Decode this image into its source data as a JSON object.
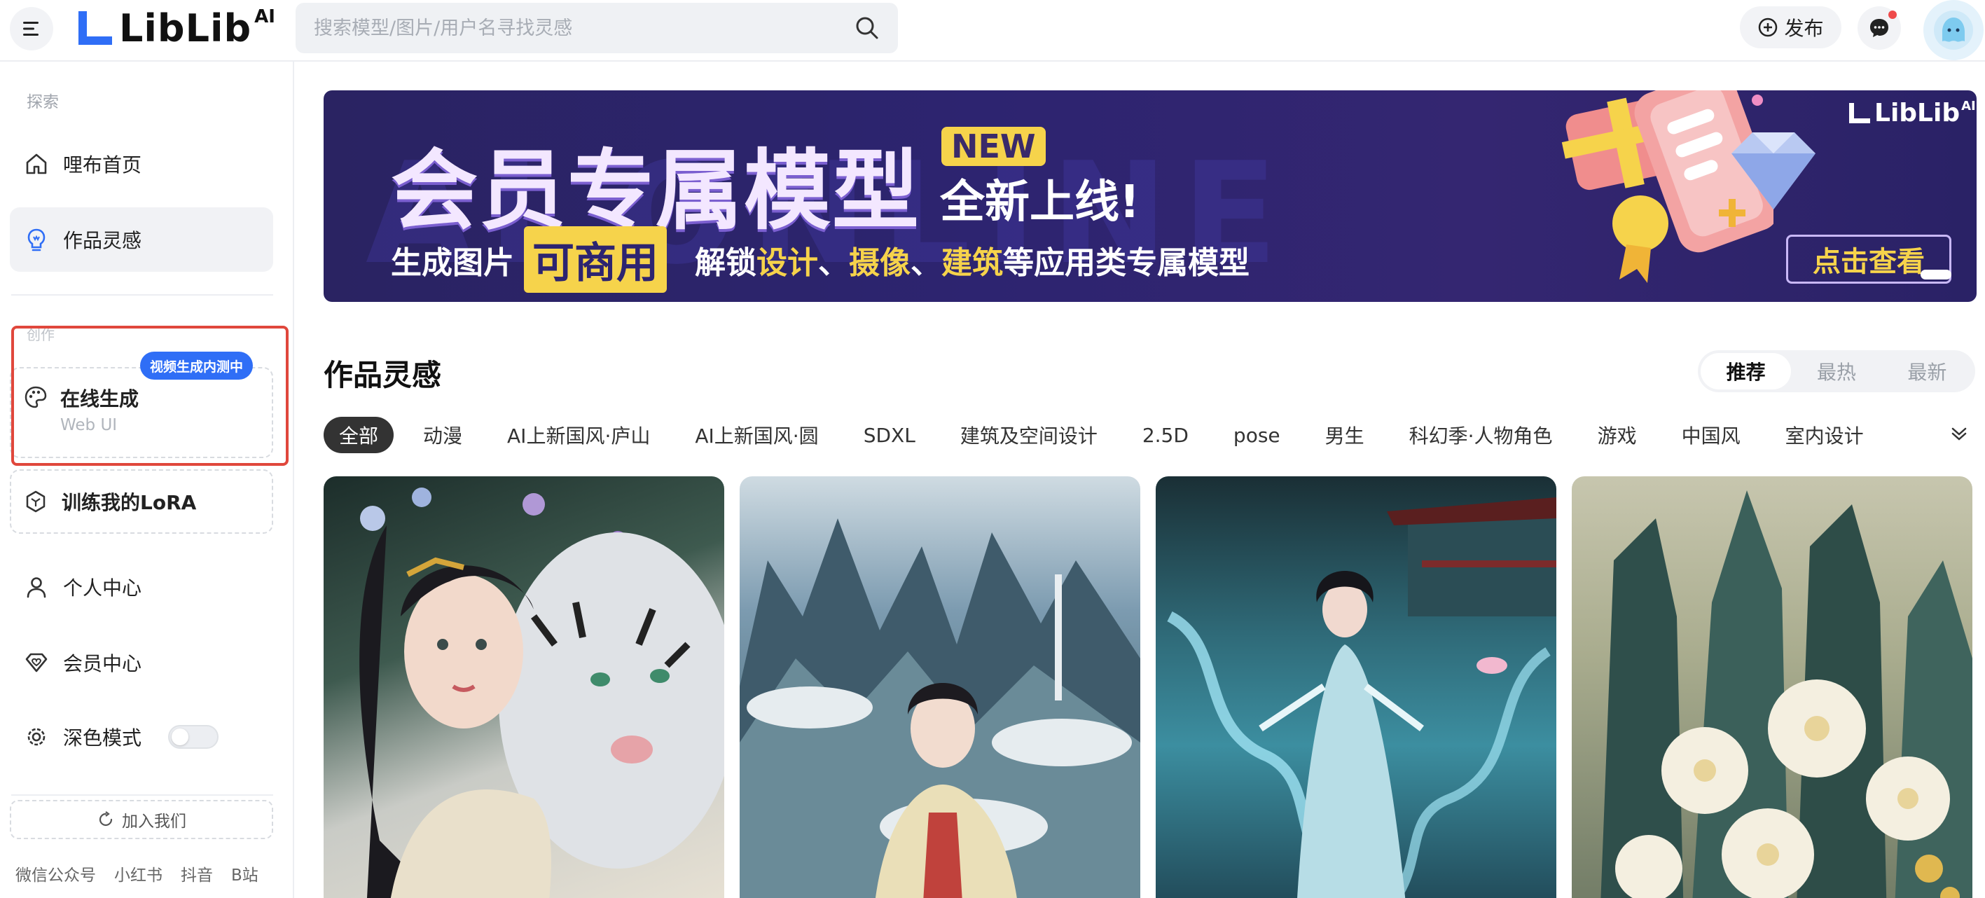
{
  "header": {
    "logo_text": "LibLib",
    "logo_suffix": "AI",
    "search_placeholder": "搜索模型/图片/用户名寻找灵感",
    "publish_label": "发布"
  },
  "sidebar": {
    "explore_label": "探索",
    "home_label": "哩布首页",
    "inspiration_label": "作品灵感",
    "create_label": "创作",
    "online_gen_title": "在线生成",
    "online_gen_sub": "Web UI",
    "video_badge": "视频生成内测中",
    "lora_label": "训练我的LoRA",
    "personal_label": "个人中心",
    "member_label": "会员中心",
    "dark_mode_label": "深色模式",
    "join_label": "加入我们",
    "footer_links": [
      "微信公众号",
      "小红书",
      "抖音",
      "B站"
    ]
  },
  "banner": {
    "title": "会员专属模型",
    "new_badge": "NEW",
    "title2": "全新上线!",
    "sub_prefix": "生成图片",
    "sub_highlight": "可商用",
    "sub_part1": "解锁",
    "sub_y1": "设计",
    "sub_sep1": "、",
    "sub_y2": "摄像",
    "sub_sep2": "、",
    "sub_y3": "建筑",
    "sub_part2": "等应用类专属模型",
    "cta": "点击查看",
    "brand": "LibLib",
    "brand_suffix": "AI"
  },
  "main": {
    "section_title": "作品灵感",
    "sort_tabs": [
      "推荐",
      "最热",
      "最新"
    ],
    "categories": [
      "全部",
      "动漫",
      "AI上新国风·庐山",
      "AI上新国风·圆",
      "SDXL",
      "建筑及空间设计",
      "2.5D",
      "pose",
      "男生",
      "科幻季·人物角色",
      "游戏",
      "中国风",
      "室内设计"
    ]
  },
  "colors": {
    "accent_blue": "#2f6ef6",
    "highlight_red": "#e0473c",
    "banner_yellow": "#f6d34b",
    "banner_bg": "#2d2470"
  }
}
